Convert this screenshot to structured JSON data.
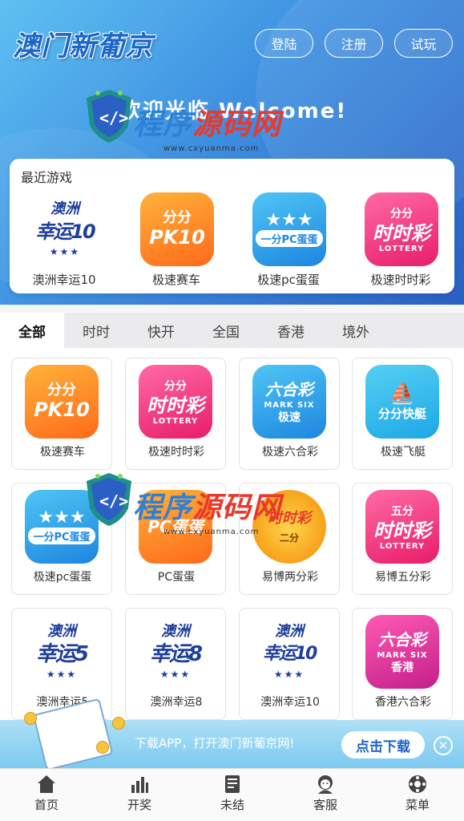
{
  "header": {
    "logo": "澳门新葡京",
    "buttons": [
      "登陆",
      "注册",
      "试玩"
    ],
    "welcome": "欢迎光临 Welcome!"
  },
  "watermark": {
    "text1": "程序",
    "text2": "源码网",
    "url": "www.cxyuanma.com"
  },
  "recent": {
    "title": "最近游戏",
    "items": [
      {
        "label": "澳洲幸运10",
        "icon": "lucky-10-icon",
        "line1": "澳洲",
        "line2": "幸运10"
      },
      {
        "label": "极速赛车",
        "icon": "pk10-icon",
        "line1": "分分",
        "line2": "PK10"
      },
      {
        "label": "极速pc蛋蛋",
        "icon": "pc-egg-icon",
        "line1": "★★★",
        "line2": "一分PC蛋蛋"
      },
      {
        "label": "极速时时彩",
        "icon": "ssc-icon",
        "line1": "分分",
        "line2": "时时彩",
        "line3": "LOTTERY"
      }
    ]
  },
  "tabs": [
    "全部",
    "时时",
    "快开",
    "全国",
    "香港",
    "境外"
  ],
  "games": [
    {
      "label": "极速赛车",
      "line1": "分分",
      "line2": "PK10"
    },
    {
      "label": "极速时时彩",
      "line1": "分分",
      "line2": "时时彩",
      "line3": "LOTTERY"
    },
    {
      "label": "极速六合彩",
      "line1": "六合彩",
      "line2": "MARK SIX",
      "line3": "极速"
    },
    {
      "label": "极速飞艇",
      "line1": "分分快艇"
    },
    {
      "label": "极速pc蛋蛋",
      "line1": "★★★",
      "line2": "一分PC蛋蛋"
    },
    {
      "label": "PC蛋蛋",
      "line1": "PC蛋蛋"
    },
    {
      "label": "易博两分彩",
      "line1": "时时彩",
      "line2": "二分"
    },
    {
      "label": "易博五分彩",
      "line1": "五分",
      "line2": "时时彩",
      "line3": "LOTTERY"
    },
    {
      "label": "澳洲幸运5",
      "line1": "澳洲",
      "line2": "幸运5"
    },
    {
      "label": "澳洲幸运8",
      "line1": "澳洲",
      "line2": "幸运8"
    },
    {
      "label": "澳洲幸运10",
      "line1": "澳洲",
      "line2": "幸运10"
    },
    {
      "label": "香港六合彩",
      "line1": "六合彩",
      "line2": "MARK SIX",
      "line3": "香港"
    }
  ],
  "banner": {
    "text": "下载APP，打开澳门新葡京网!",
    "button": "点击下载",
    "close": "✕"
  },
  "nav": [
    "首页",
    "开奖",
    "未结",
    "客服",
    "菜单"
  ],
  "colors": {
    "header_start": "#5fc0f2",
    "header_end": "#2a5fc3",
    "accent": "#1e63c8"
  }
}
